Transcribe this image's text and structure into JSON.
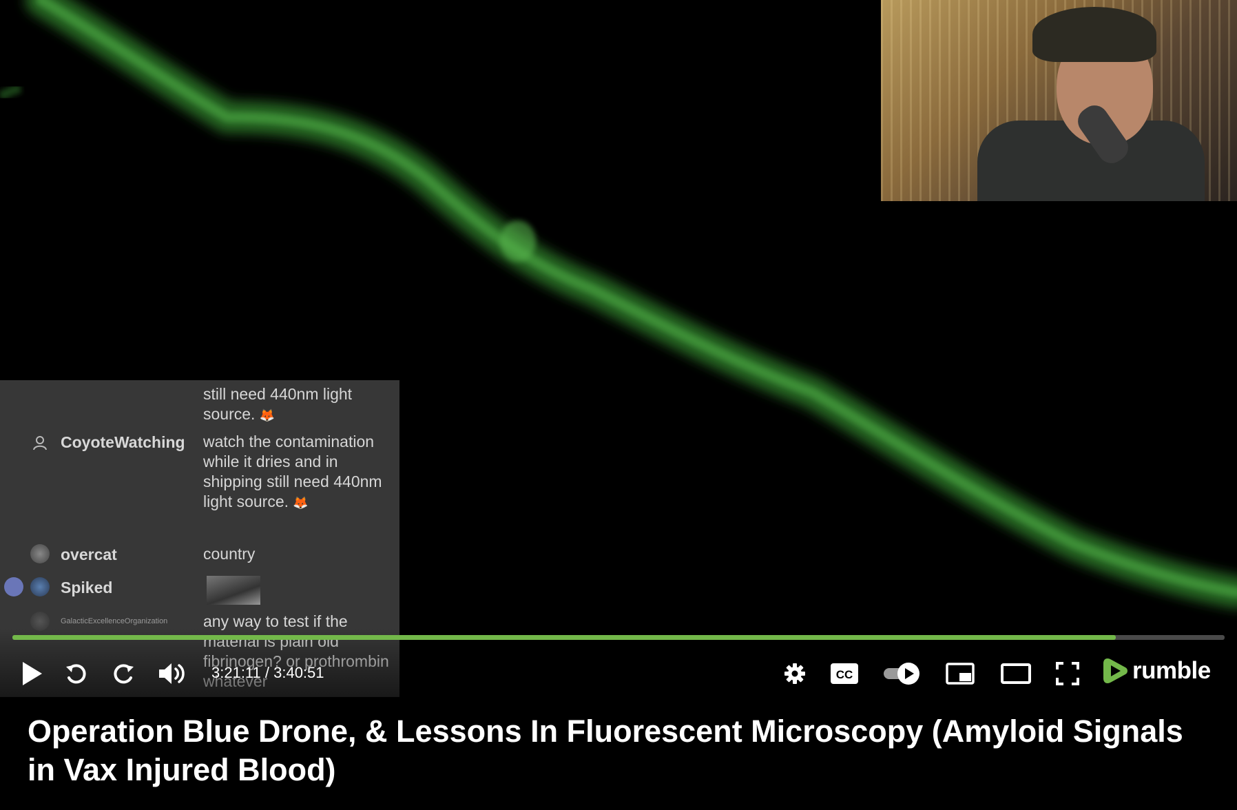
{
  "player": {
    "time_display": "3:21:11 / 3:40:51",
    "progress_fraction": 0.9105,
    "brand": "rumble",
    "colors": {
      "progress": "#73b84a",
      "brand": "#73b84a",
      "fluorescence": "#3c8a34"
    }
  },
  "chat": {
    "messages": [
      {
        "user": "",
        "text": "still need 440nm light source."
      },
      {
        "user": "CoyoteWatching",
        "text": "watch the contamination while it dries and in shipping still need 440nm light source."
      },
      {
        "user": "overcat",
        "text": "country"
      },
      {
        "user": "Spiked",
        "text": ""
      },
      {
        "user": "GalacticExcellenceOrganization",
        "text": "any way to test if the material is plain old fibrinogen? or prothrombin whatever"
      }
    ]
  },
  "video": {
    "title": "Operation Blue Drone, & Lessons In Fluorescent Microscopy (Amyloid Signals in Vax Injured Blood)"
  }
}
